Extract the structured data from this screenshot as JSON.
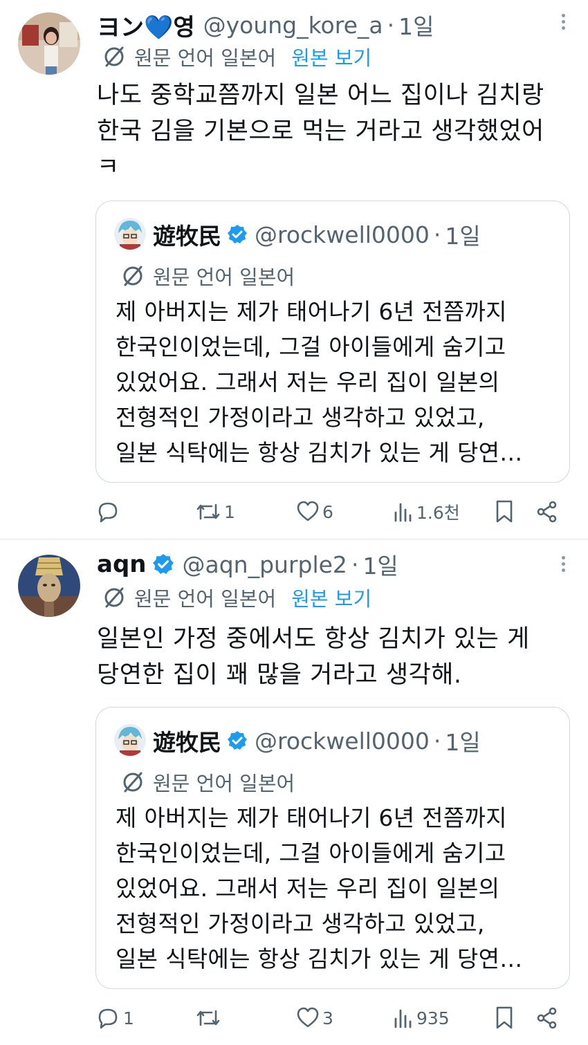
{
  "colors": {
    "text": "#0f1419",
    "secondary": "#536471",
    "link": "#1d9bf0",
    "verified": "#1d9bf0",
    "border": "#cfd9de"
  },
  "tweets": [
    {
      "name": "ヨン💙영",
      "handle": "@young_kore_a",
      "separator": "·",
      "time": "1일",
      "verified": false,
      "translation_label": "원문 언어 일본어",
      "show_original": "원본 보기",
      "text": "나도 중학교쯤까지 일본 어느 집이나 김치랑\n한국 김을 기본으로 먹는 거라고 생각했었어\nㅋ",
      "quote": {
        "name": "遊牧民",
        "handle": "@rockwell0000",
        "separator": "·",
        "time": "1일",
        "verified": true,
        "translation_label": "원문 언어 일본어",
        "text": "제 아버지는 제가 태어나기 6년 전쯤까지\n한국인이었는데, 그걸 아이들에게 숨기고\n있었어요. 그래서 저는 우리 집이 일본의\n전형적인 가정이라고 생각하고 있었고,\n일본 식탁에는 항상 김치가 있는 게 당연…"
      },
      "stats": {
        "replies": "",
        "retweets": "1",
        "likes": "6",
        "views": "1.6천"
      },
      "icons": [
        "reply-icon",
        "retweet-icon",
        "like-icon",
        "views-icon",
        "bookmark-icon",
        "share-icon"
      ]
    },
    {
      "name": "aqn",
      "handle": "@aqn_purple2",
      "separator": "·",
      "time": "1일",
      "verified": true,
      "translation_label": "원문 언어 일본어",
      "show_original": "원본 보기",
      "text": "일본인 가정 중에서도 항상 김치가 있는 게\n당연한 집이 꽤 많을 거라고 생각해.",
      "quote": {
        "name": "遊牧民",
        "handle": "@rockwell0000",
        "separator": "·",
        "time": "1일",
        "verified": true,
        "translation_label": "원문 언어 일본어",
        "text": "제 아버지는 제가 태어나기 6년 전쯤까지\n한국인이었는데, 그걸 아이들에게 숨기고\n있었어요. 그래서 저는 우리 집이 일본의\n전형적인 가정이라고 생각하고 있었고,\n일본 식탁에는 항상 김치가 있는 게 당연…"
      },
      "stats": {
        "replies": "1",
        "retweets": "",
        "likes": "3",
        "views": "935"
      },
      "icons": [
        "reply-icon",
        "retweet-icon",
        "like-icon",
        "views-icon",
        "bookmark-icon",
        "share-icon"
      ]
    }
  ]
}
